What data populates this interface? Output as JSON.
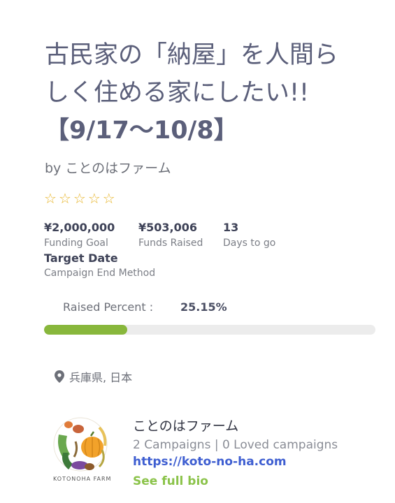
{
  "campaign": {
    "title_lines": [
      "古民家の「納屋」を人間ら",
      "しく住める家にしたい!!",
      "【9/17〜10/8】"
    ],
    "byline": "by ことのはファーム",
    "rating_stars": 5,
    "stats": {
      "goal_value": "¥2,000,000",
      "goal_label": "Funding Goal",
      "raised_value": "¥503,006",
      "raised_label": "Funds Raised",
      "days_value": "13",
      "days_label": "Days to go"
    },
    "target": {
      "title": "Target Date",
      "sub": "Campaign End Method"
    },
    "raised_percent_label": "Raised Percent :",
    "raised_percent_value": "25.15%",
    "progress_fraction": 0.2515,
    "location": "兵庫県, 日本"
  },
  "author": {
    "name": "ことのはファーム",
    "campaigns": "2 Campaigns | 0 Loved campaigns",
    "website": "https://koto-no-ha.com",
    "bio_link": "See full bio",
    "logo_text": "KOTONOHA FARM"
  },
  "colors": {
    "accent_green": "#88b73c",
    "link_blue": "#3e5ed1",
    "star": "#e7b52b"
  },
  "icons": {
    "star": "star-outline-icon",
    "location": "map-pin-icon"
  }
}
